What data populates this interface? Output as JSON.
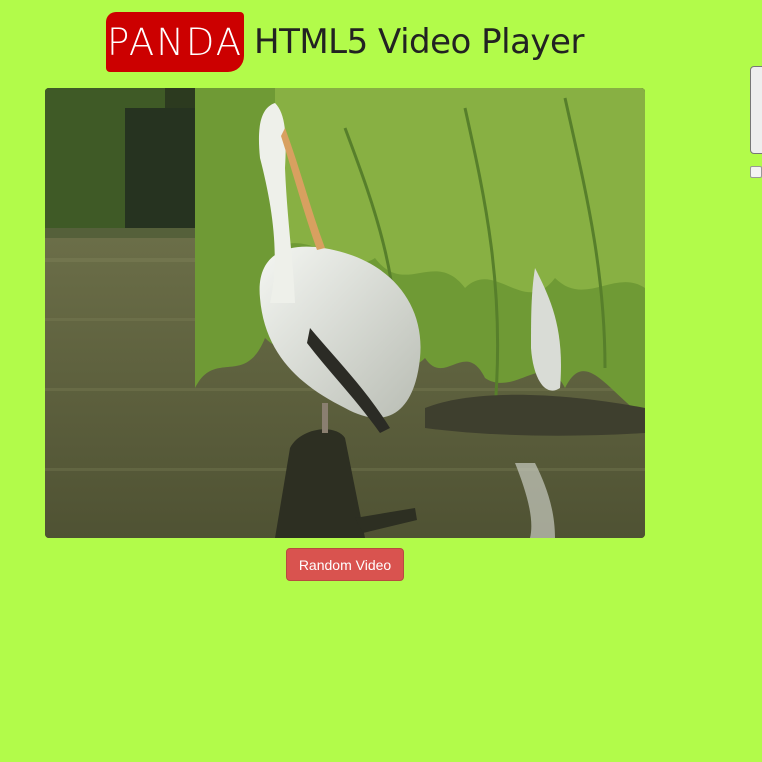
{
  "header": {
    "logo_text": "PANDA",
    "title": "HTML5 Video Player"
  },
  "video": {
    "subject": "pelican on a tree stump in a pond under willow branches"
  },
  "controls": {
    "random_video_label": "Random Video"
  },
  "colors": {
    "page_background": "#b2fb4a",
    "logo_background": "#cc0000",
    "button_background": "#d9534f"
  }
}
